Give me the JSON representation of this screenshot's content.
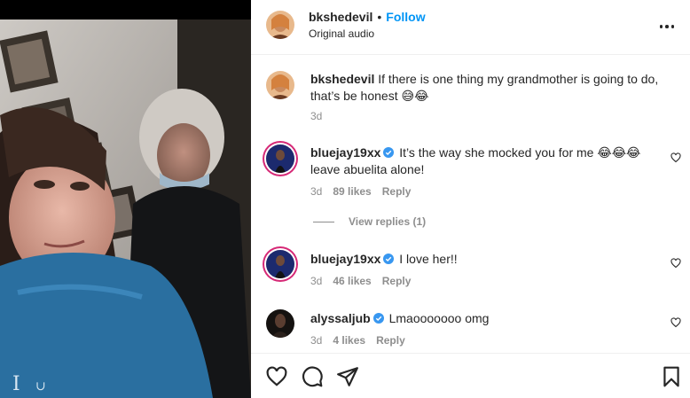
{
  "post": {
    "username": "bkshedevil",
    "follow_label": "Follow",
    "separator": "•",
    "audio": "Original audio",
    "more_icon": "more-horizontal-icon"
  },
  "caption": {
    "username": "bkshedevil",
    "text": "If there is one thing my grandmother is going to do, that’s be honest 😅😂",
    "time": "3d"
  },
  "comments": [
    {
      "username": "bluejay19xx",
      "verified": true,
      "text": "It’s the way she mocked you for me 😂😂😂 leave abuelita alone!",
      "time": "3d",
      "likes": "89 likes",
      "reply": "Reply"
    },
    {
      "username": "bluejay19xx",
      "verified": true,
      "text": "I love her!!",
      "time": "3d",
      "likes": "46 likes",
      "reply": "Reply"
    },
    {
      "username": "alyssaljub",
      "verified": true,
      "text": "Lmaooooooo omg",
      "time": "3d",
      "likes": "4 likes",
      "reply": "Reply"
    }
  ],
  "view_replies": "View replies (1)",
  "colors": {
    "accent": "#0095f6",
    "verified": "#3897f0",
    "muted": "#8e8e8e",
    "text": "#262626"
  },
  "icons": [
    "heart-icon",
    "comment-icon",
    "share-icon",
    "bookmark-icon"
  ]
}
